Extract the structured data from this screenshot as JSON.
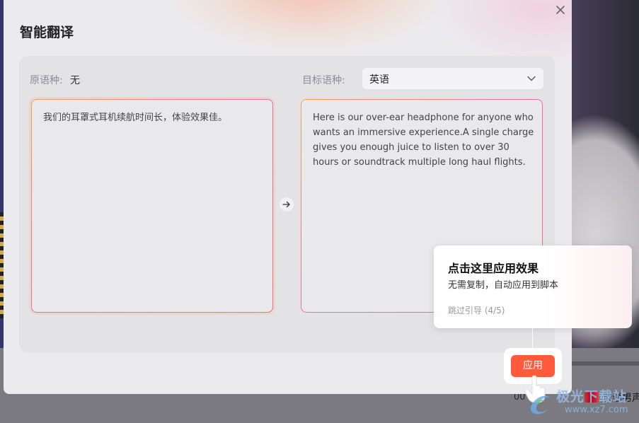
{
  "dialog": {
    "title": "智能翻译",
    "source_label": "原语种:",
    "source_value": "无",
    "target_label": "目标语种:",
    "target_selected": "英语",
    "source_text": "我们的耳罩式耳机续航时间长，体验效果佳。",
    "target_text": "Here is our over-ear headphone for anyone who wants an immersive experience.A single charge gives you enough juice to listen to over 30 hours or soundtrack multiple long haul flights."
  },
  "guide": {
    "title": "点击这里应用效果",
    "description": "无需复制，自动应用到脚本",
    "skip": "跳过引导 (4/5)",
    "apply_button": "应用"
  },
  "background": {
    "timecode": "00",
    "track_label": "汉语男声"
  },
  "watermark": {
    "title": "极光下载站",
    "url": "www.xz7.com"
  },
  "colors": {
    "accent": "#ff5a3c",
    "gradient_start": "#f0a05a",
    "gradient_end": "#ef6aa3"
  }
}
